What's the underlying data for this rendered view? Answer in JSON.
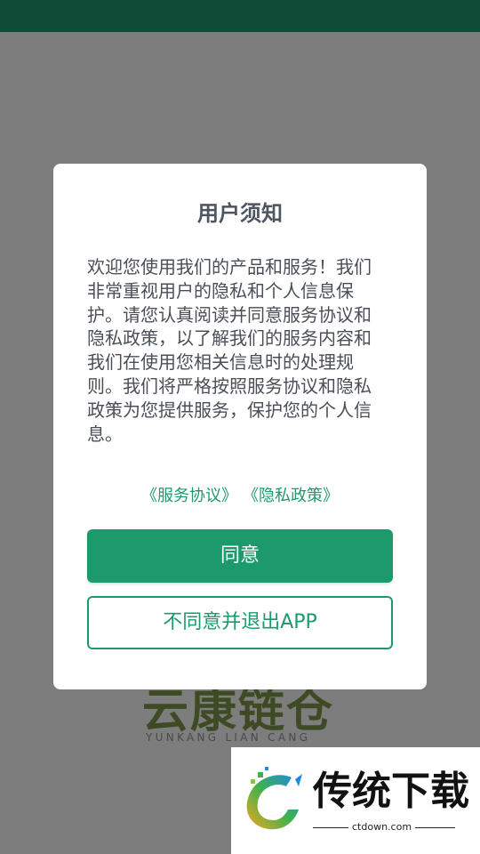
{
  "background_app": {
    "logo_mark": "云康链仓",
    "logo_subtitle": "YUNKANG LIAN CANG"
  },
  "dialog": {
    "title": "用户须知",
    "body": "欢迎您使用我们的产品和服务！我们非常重视用户的隐私和个人信息保护。请您认真阅读并同意服务协议和隐私政策，以了解我们的服务内容和我们在使用您相关信息时的处理规则。我们将严格按照服务协议和隐私政策为您提供服务，保护您的个人信息。",
    "links": {
      "terms": "《服务协议》",
      "privacy": "《隐私政策》"
    },
    "agree_label": "同意",
    "disagree_label": "不同意并退出APP"
  },
  "watermark": {
    "text": "传统下载",
    "url": "ctdown.com"
  },
  "colors": {
    "status_bar": "#0e4c38",
    "overlay": "#7d7d7d",
    "accent": "#1d9a6c",
    "body_text": "#4a4f57",
    "title_text": "#4d5561"
  }
}
